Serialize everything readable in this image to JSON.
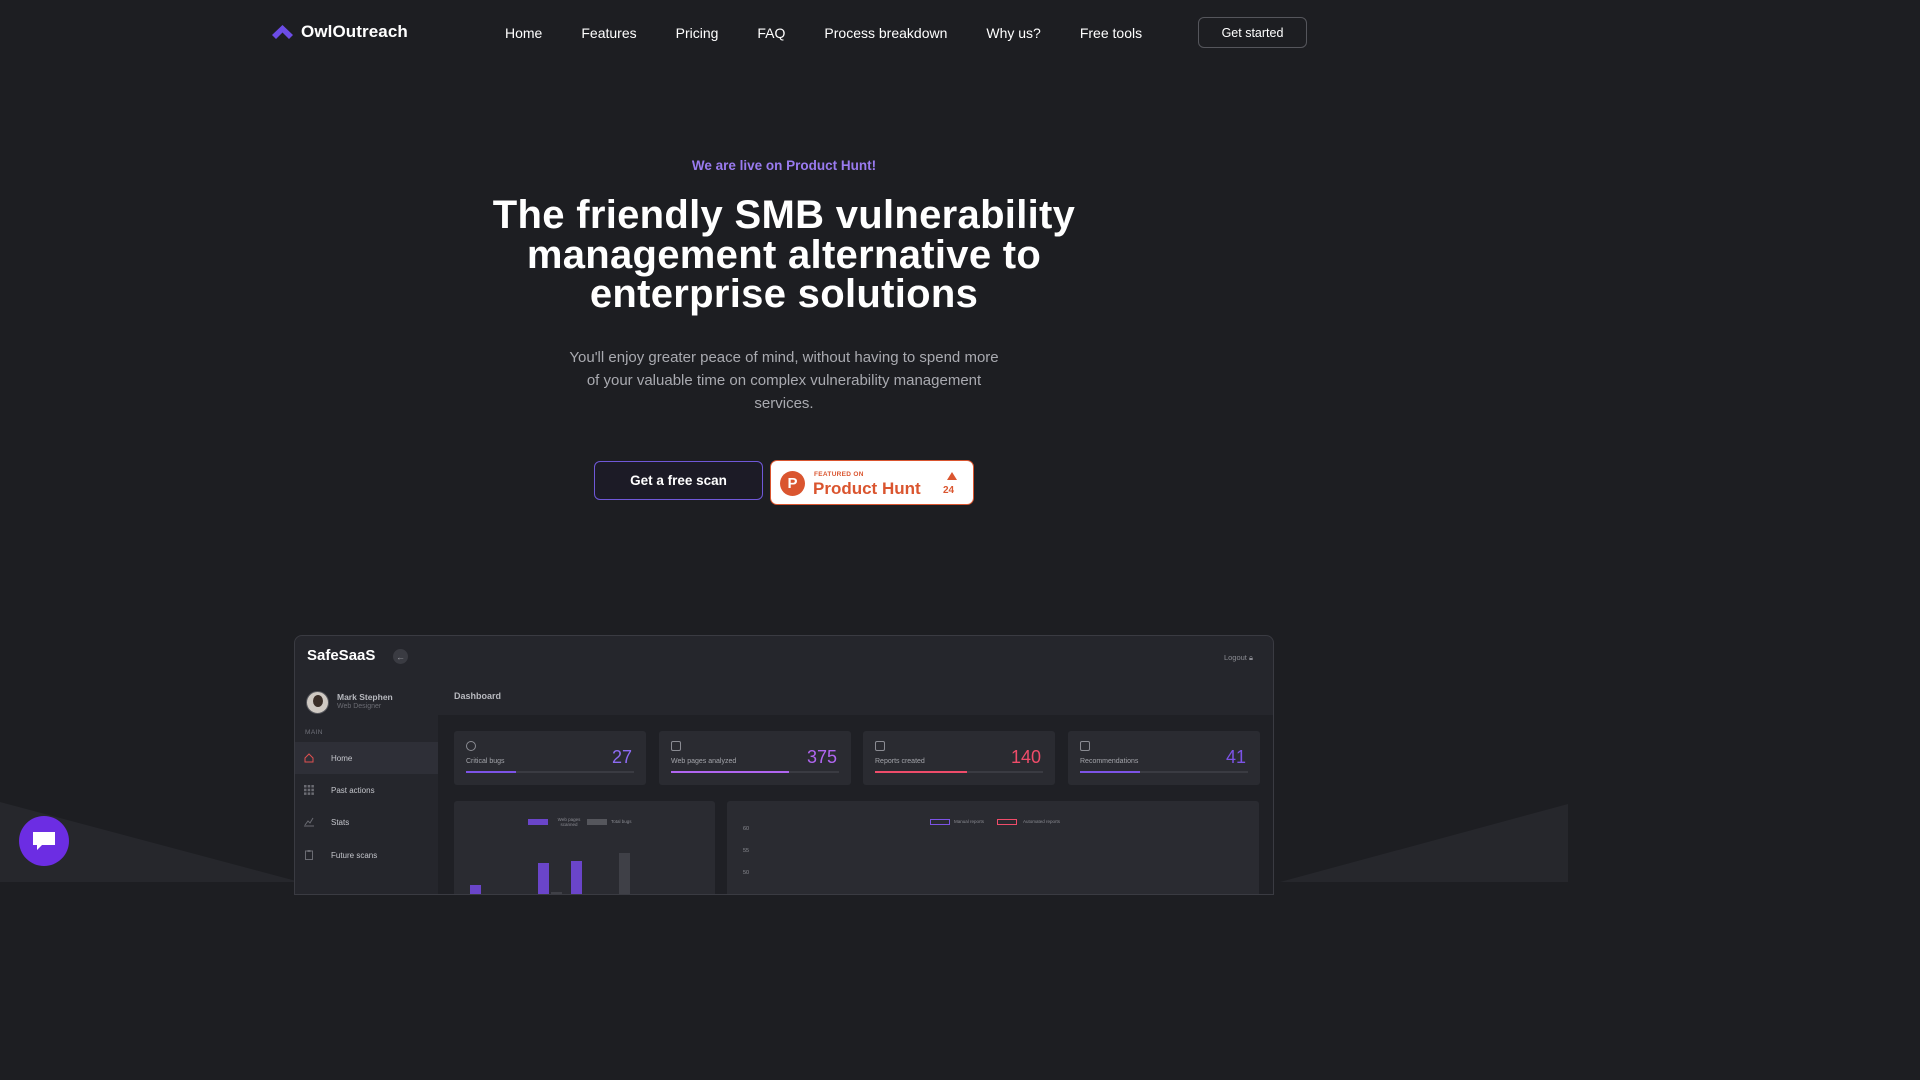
{
  "brand": {
    "name": "OwlOutreach",
    "accent": "#6c4ce6"
  },
  "nav": {
    "links": [
      "Home",
      "Features",
      "Pricing",
      "FAQ",
      "Process breakdown",
      "Why us?",
      "Free tools"
    ],
    "cta": "Get started"
  },
  "hero": {
    "eyebrow": "We are live on Product Hunt!",
    "title": "The friendly SMB vulnerability management alternative to enterprise solutions",
    "subtitle": "You'll enjoy greater peace of mind, without having to spend more of your valuable time on complex vulnerability management services.",
    "primary_cta": "Get a free scan",
    "product_hunt": {
      "featured": "FEATURED ON",
      "name": "Product Hunt",
      "votes": "24",
      "color": "#da552f"
    }
  },
  "dashboard": {
    "brand": "SafeSaaS",
    "logout": "Logout",
    "user": {
      "name": "Mark Stephen",
      "role": "Web Designer"
    },
    "section": "MAIN",
    "sidebar": [
      "Home",
      "Past actions",
      "Stats",
      "Future scans"
    ],
    "title": "Dashboard",
    "stats": [
      {
        "label": "Critical bugs",
        "value": "27",
        "progress": 0.3
      },
      {
        "label": "Web pages analyzed",
        "value": "375",
        "progress": 0.7
      },
      {
        "label": "Reports created",
        "value": "140",
        "progress": 0.55
      },
      {
        "label": "Recommendations",
        "value": "41",
        "progress": 0.36
      }
    ],
    "bar_legend": [
      "Web pages scanned",
      "Total bugs"
    ],
    "line_legend": [
      "Manual reports",
      "Automated reports"
    ],
    "y_ticks": [
      "60",
      "55",
      "50"
    ]
  }
}
